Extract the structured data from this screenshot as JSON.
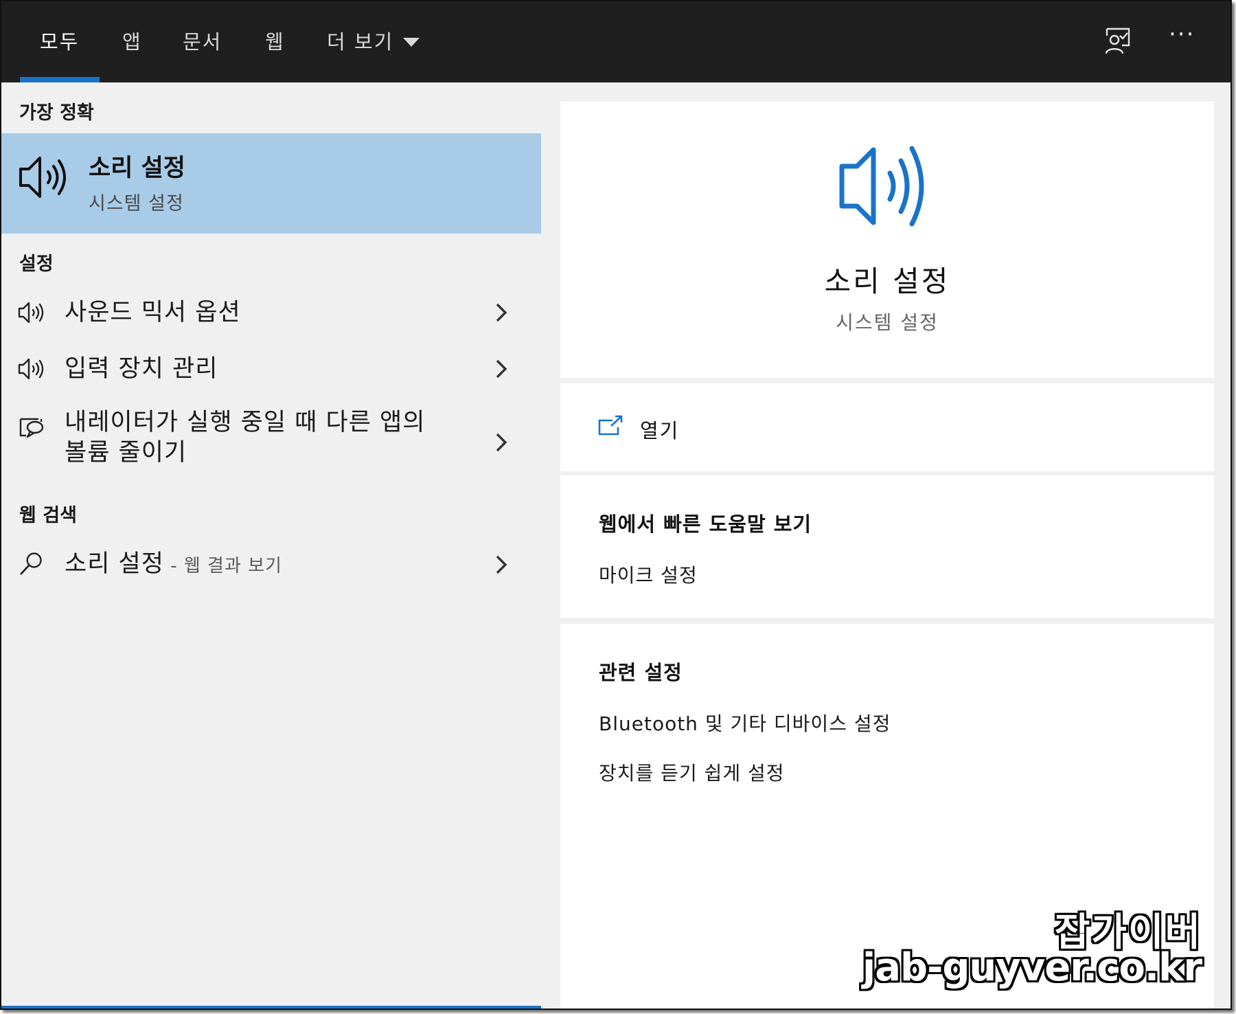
{
  "tabs": [
    {
      "label": "모두",
      "active": true
    },
    {
      "label": "앱"
    },
    {
      "label": "문서"
    },
    {
      "label": "웹"
    },
    {
      "label": "더 보기"
    }
  ],
  "top_icons": {
    "feedback": "feedback-icon",
    "more": "more-options-icon",
    "more_glyph": "···"
  },
  "left": {
    "best_match_header": "가장 정확",
    "best_match": {
      "title": "소리 설정",
      "subtitle": "시스템 설정",
      "icon": "speaker-icon"
    },
    "settings_header": "설정",
    "settings_items": [
      {
        "label": "사운드 믹서 옵션",
        "icon": "speaker-icon"
      },
      {
        "label": "입력 장치 관리",
        "icon": "speaker-icon"
      },
      {
        "label_line1": "내레이터가 실행 중일 때 다른 앱의",
        "label_line2": "볼륨 줄이기",
        "icon": "narrator-icon"
      }
    ],
    "web_header": "웹 검색",
    "web_item": {
      "label": "소리 설정",
      "suffix": " - 웹 결과 보기",
      "icon": "search-icon"
    }
  },
  "right": {
    "hero": {
      "title": "소리 설정",
      "subtitle": "시스템 설정",
      "icon": "speaker-icon"
    },
    "open_label": "열기",
    "web_help_header": "웹에서 빠른 도움말 보기",
    "web_help_links": [
      "마이크 설정"
    ],
    "related_header": "관련 설정",
    "related_links": [
      "Bluetooth 및 기타 디바이스 설정",
      "장치를 듣기 쉽게 설정"
    ]
  },
  "watermark": {
    "line1": "잡가이버",
    "line2": "jab-guyver.co.kr"
  },
  "colors": {
    "topbar": "#1f1f1f",
    "accent": "#1a73c9",
    "selected": "#a8cbe8",
    "panel": "#f0f0f0"
  }
}
